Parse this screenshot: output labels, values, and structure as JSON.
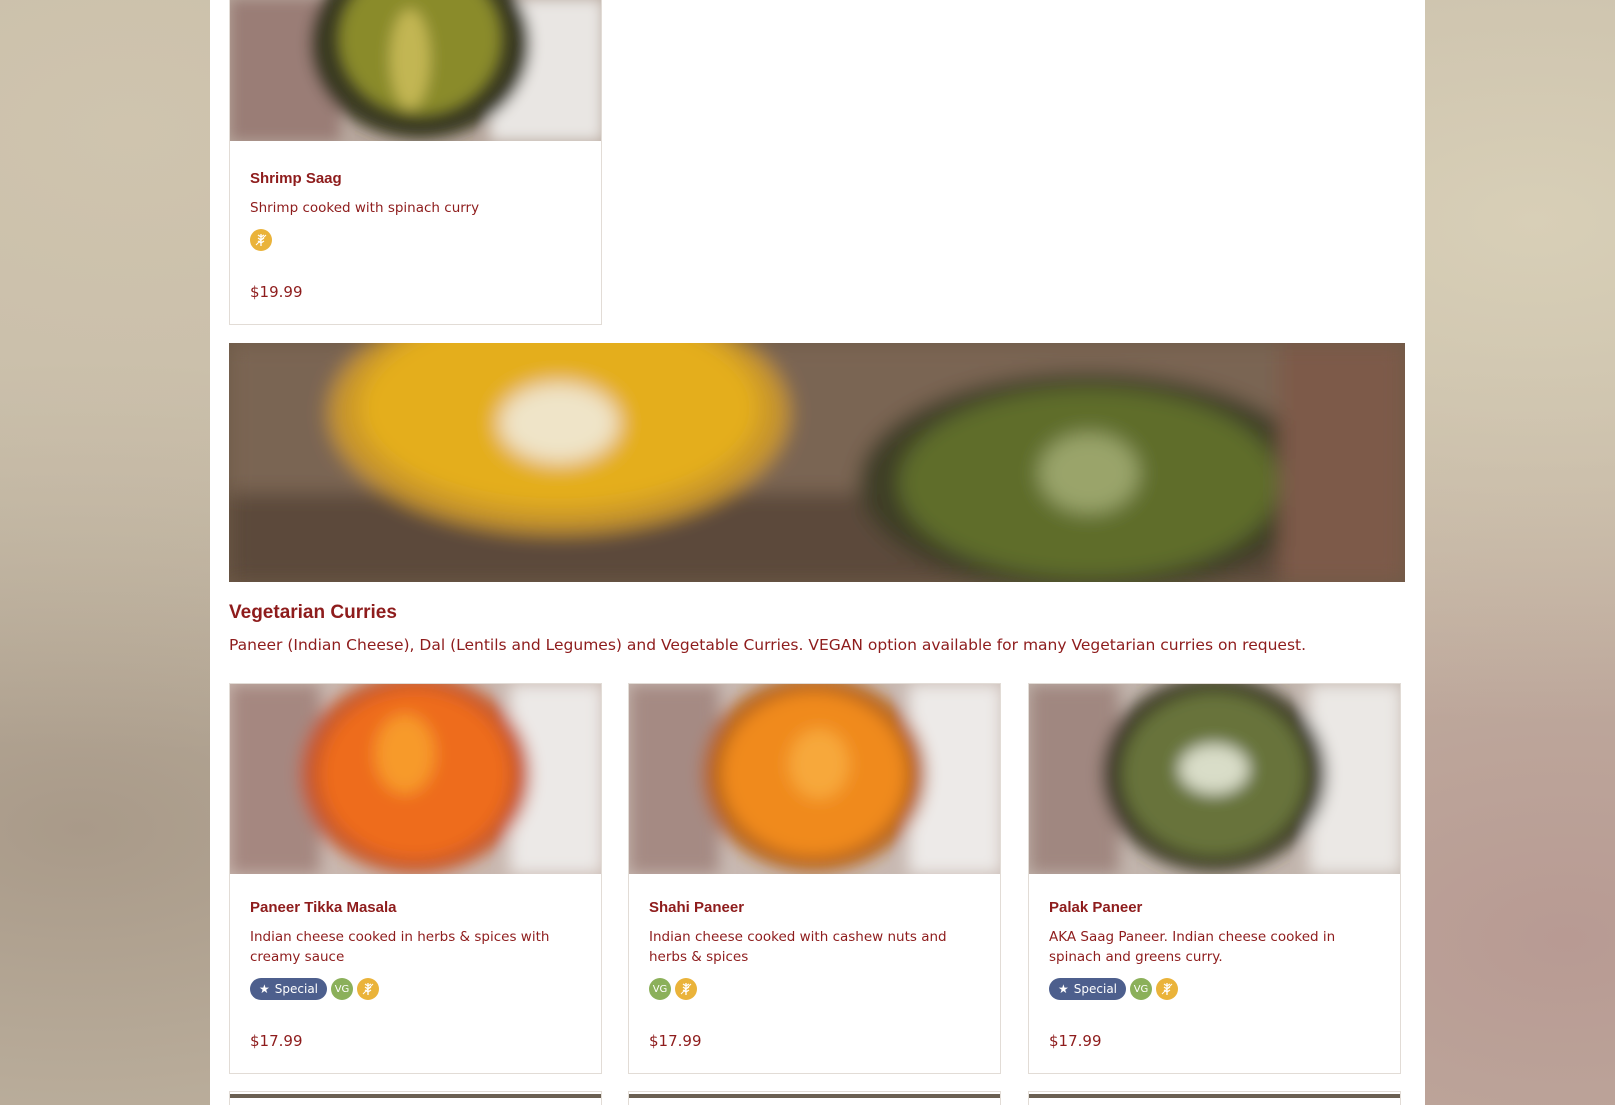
{
  "previous_section": {
    "item": {
      "name": "Shrimp Saag",
      "description": "Shrimp cooked with spinach curry",
      "price": "$19.99",
      "icons": [
        "gluten-free-icon"
      ]
    }
  },
  "section": {
    "title": "Vegetarian Curries",
    "description": "Paneer (Indian Cheese), Dal (Lentils and Legumes) and Vegetable Curries. VEGAN option available for many Vegetarian curries on request."
  },
  "items": [
    {
      "name": "Paneer Tikka Masala",
      "description": "Indian cheese cooked in herbs & spices with creamy sauce",
      "special_label": "Special",
      "vg_label": "VG",
      "price": "$17.99"
    },
    {
      "name": "Shahi Paneer",
      "description": "Indian cheese cooked with cashew nuts and herbs & spices",
      "vg_label": "VG",
      "price": "$17.99"
    },
    {
      "name": "Palak Paneer",
      "description": "AKA Saag Paneer. Indian cheese cooked in spinach and greens curry.",
      "special_label": "Special",
      "vg_label": "VG",
      "price": "$17.99"
    }
  ],
  "colors": {
    "accent_text": "#8e1c1c",
    "special_badge": "#4d5f8d",
    "vegan_badge": "#8bb05a",
    "gluten_free_badge": "#eab33a"
  }
}
